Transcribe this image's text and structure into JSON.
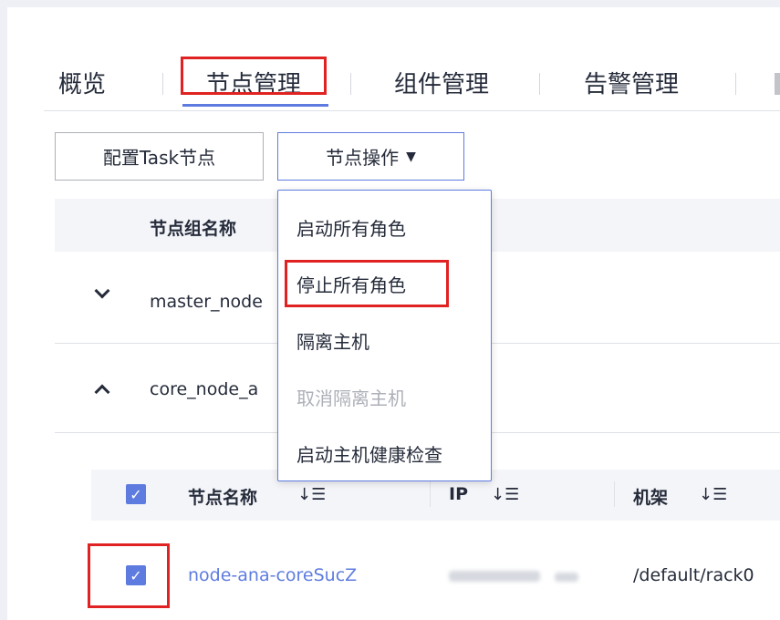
{
  "tabs": [
    {
      "label": "概览"
    },
    {
      "label": "节点管理",
      "active": true
    },
    {
      "label": "组件管理"
    },
    {
      "label": "告警管理"
    }
  ],
  "toolbar": {
    "config_task_label": "配置Task节点",
    "node_ops_label": "节点操作"
  },
  "node_group_table": {
    "header": "节点组名称",
    "rows": [
      {
        "name": "master_node",
        "expanded": false
      },
      {
        "name": "core_node_a",
        "expanded": true
      }
    ]
  },
  "dropdown": {
    "items": [
      {
        "label": "启动所有角色",
        "disabled": false
      },
      {
        "label": "停止所有角色",
        "disabled": false
      },
      {
        "label": "隔离主机",
        "disabled": false
      },
      {
        "label": "取消隔离主机",
        "disabled": true
      },
      {
        "label": "启动主机健康检查",
        "disabled": false
      }
    ]
  },
  "node_table": {
    "headers": {
      "name": "节点名称",
      "ip": "IP",
      "rack": "机架"
    },
    "rows": [
      {
        "name": "node-ana-coreSucZ",
        "rack": "/default/rack0",
        "checked": true
      }
    ]
  },
  "colors": {
    "accent": "#5e7ce0",
    "highlight": "#e02222",
    "text": "#252b3a",
    "disabled": "#adb0b8"
  }
}
